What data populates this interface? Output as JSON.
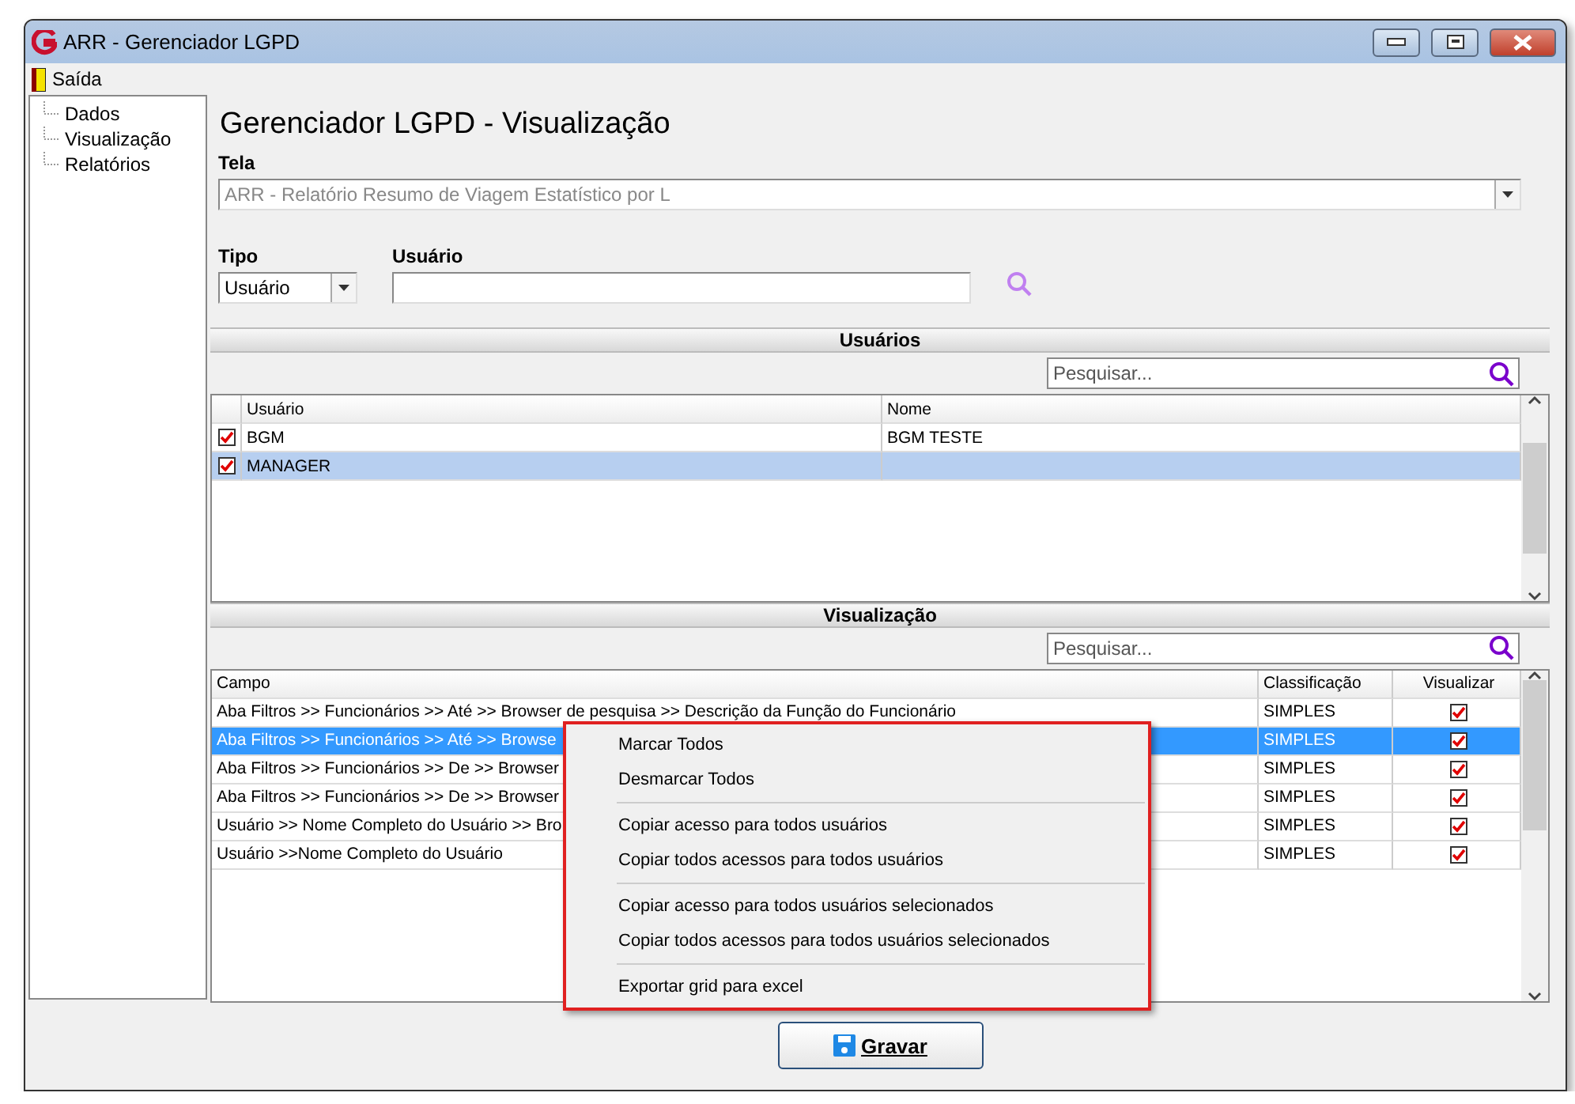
{
  "window": {
    "title": "ARR - Gerenciador LGPD"
  },
  "menu": [
    {
      "label": "Saída"
    }
  ],
  "tree": [
    {
      "label": "Dados"
    },
    {
      "label": "Visualização"
    },
    {
      "label": "Relatórios"
    }
  ],
  "heading": "Gerenciador LGPD - Visualização",
  "tela": {
    "label": "Tela",
    "value": "ARR - Relatório Resumo de Viagem Estatístico por L",
    "disabled": true
  },
  "tipo": {
    "label": "Tipo",
    "value": "Usuário"
  },
  "usuario": {
    "label": "Usuário"
  },
  "users_section": {
    "title": "Usuários",
    "search": {
      "placeholder": "Pesquisar..."
    },
    "columns": [
      "Usuário",
      "Nome"
    ],
    "rows": [
      {
        "checked": true,
        "selected": false,
        "cells": [
          "BGM",
          "BGM TESTE"
        ]
      },
      {
        "checked": true,
        "selected": true,
        "cells": [
          "MANAGER",
          ""
        ]
      }
    ]
  },
  "view_section": {
    "title": "Visualização",
    "search": {
      "placeholder": "Pesquisar..."
    },
    "columns": [
      "Campo",
      "Classificação",
      "Visualizar"
    ],
    "rows": [
      {
        "campo": "Aba Filtros >> Funcionários >> Até >> Browser de pesquisa >> Descrição da Função do Funcionário",
        "classificacao": "SIMPLES",
        "visualizar": true,
        "selected": false
      },
      {
        "campo": "Aba Filtros >> Funcionários >> Até >> Browse",
        "classificacao": "SIMPLES",
        "visualizar": true,
        "selected": true
      },
      {
        "campo": "Aba Filtros >> Funcionários >> De >> Browser",
        "classificacao": "SIMPLES",
        "visualizar": true,
        "selected": false
      },
      {
        "campo": "Aba Filtros >> Funcionários >> De >> Browser",
        "classificacao": "SIMPLES",
        "visualizar": true,
        "selected": false
      },
      {
        "campo": "Usuário >> Nome Completo do Usuário >> Bro",
        "classificacao": "SIMPLES",
        "visualizar": true,
        "selected": false
      },
      {
        "campo": "Usuário >>Nome Completo do Usuário",
        "classificacao": "SIMPLES",
        "visualizar": true,
        "selected": false
      }
    ]
  },
  "context_menu": {
    "groups": [
      {
        "items": [
          "Marcar Todos",
          "Desmarcar Todos"
        ]
      },
      {
        "items": [
          "Copiar acesso para todos usuários",
          "Copiar todos acessos para todos usuários"
        ]
      },
      {
        "items": [
          "Copiar acesso para todos usuários selecionados",
          "Copiar todos acessos para todos usuários selecionados"
        ]
      },
      {
        "items": [
          "Exportar grid para excel"
        ]
      }
    ]
  },
  "save_button": {
    "label": "Gravar"
  }
}
